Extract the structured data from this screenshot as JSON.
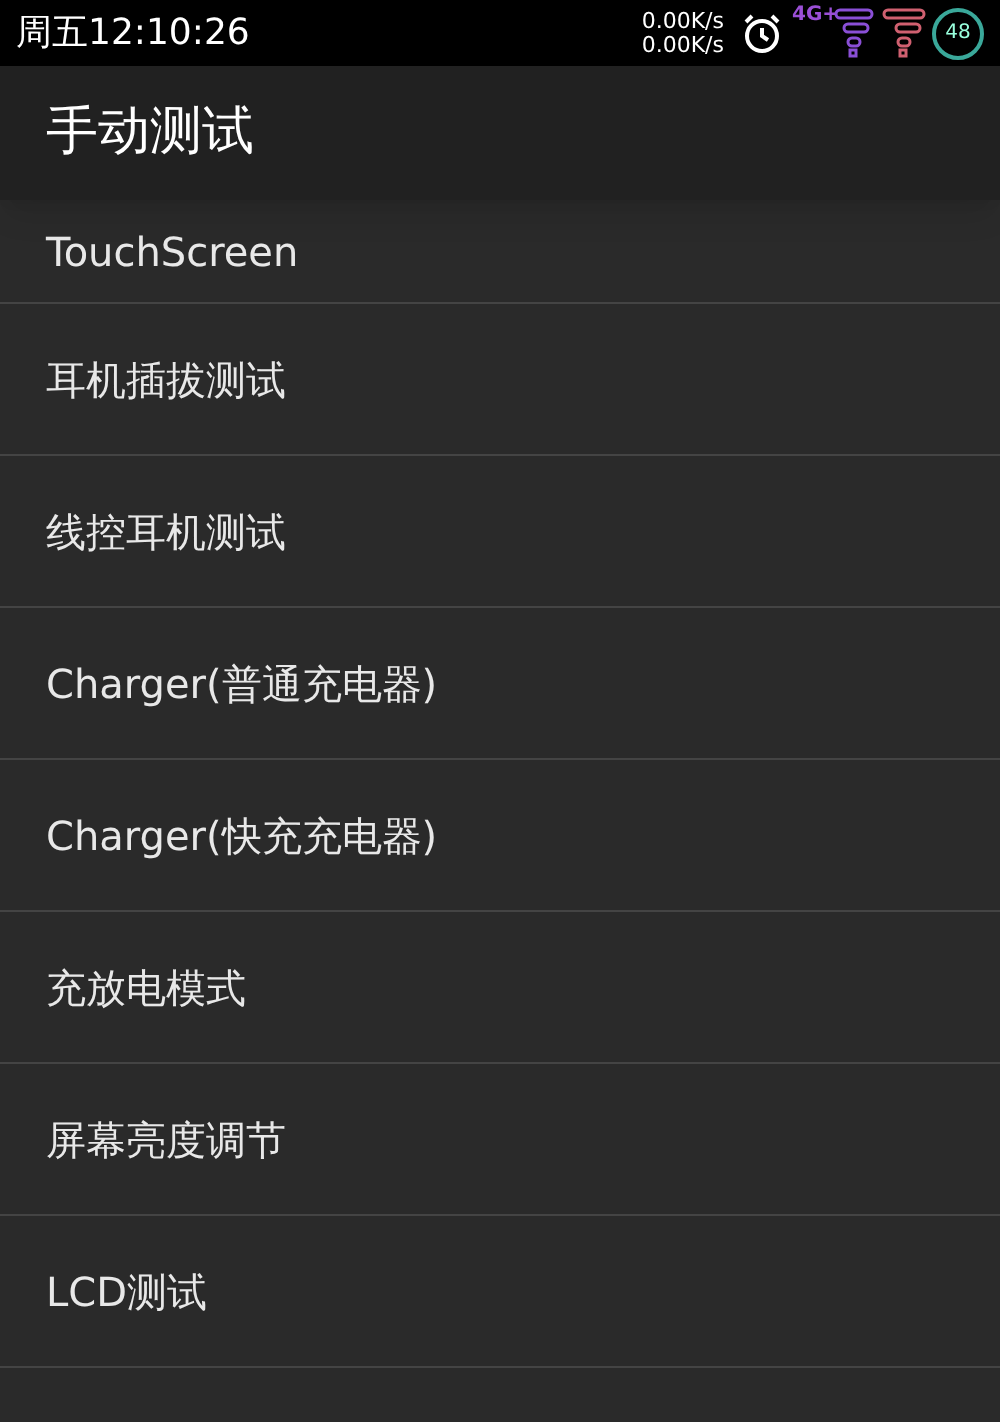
{
  "status_bar": {
    "time": "周五12:10:26",
    "net_speed_up": "0.00K/s",
    "net_speed_down": "0.00K/s",
    "network": "4G+",
    "battery": "48"
  },
  "header": {
    "title": "手动测试"
  },
  "items": [
    {
      "label": "TouchScreen"
    },
    {
      "label": "耳机插拔测试"
    },
    {
      "label": "线控耳机测试"
    },
    {
      "label": "Charger(普通充电器)"
    },
    {
      "label": "Charger(快充充电器)"
    },
    {
      "label": "充放电模式"
    },
    {
      "label": "屏幕亮度调节"
    },
    {
      "label": "LCD测试"
    }
  ]
}
